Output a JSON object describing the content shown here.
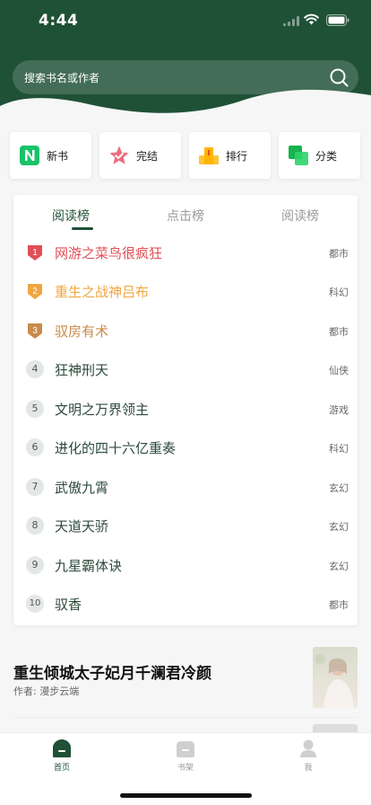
{
  "status_bar": {
    "time": "4:44"
  },
  "search": {
    "placeholder": "搜索书名或作者"
  },
  "quick_links": [
    {
      "label": "新书",
      "icon": "new-badge-icon"
    },
    {
      "label": "完结",
      "icon": "star-icon"
    },
    {
      "label": "排行",
      "icon": "ranking-icon"
    },
    {
      "label": "分类",
      "icon": "category-icon"
    }
  ],
  "rank_tabs": [
    "阅读榜",
    "点击榜",
    "阅读榜"
  ],
  "rank_list": [
    {
      "rank": "1",
      "title": "网游之菜鸟很疯狂",
      "category": "都市"
    },
    {
      "rank": "2",
      "title": "重生之战神吕布",
      "category": "科幻"
    },
    {
      "rank": "3",
      "title": "驭房有术",
      "category": "都市"
    },
    {
      "rank": "4",
      "title": "狂神刑天",
      "category": "仙侠"
    },
    {
      "rank": "5",
      "title": "文明之万界领主",
      "category": "游戏"
    },
    {
      "rank": "6",
      "title": "进化的四十六亿重奏",
      "category": "科幻"
    },
    {
      "rank": "7",
      "title": "武傲九霄",
      "category": "玄幻"
    },
    {
      "rank": "8",
      "title": "天道天骄",
      "category": "玄幻"
    },
    {
      "rank": "9",
      "title": "九星霸体诀",
      "category": "玄幻"
    },
    {
      "rank": "10",
      "title": "驭香",
      "category": "都市"
    }
  ],
  "recommendation": {
    "title": "重生倾城太子妃月千澜君冷颜",
    "author": "作者: 漫步云端"
  },
  "tabbar": [
    {
      "label": "首页",
      "icon": "home-icon",
      "active": true
    },
    {
      "label": "书架",
      "icon": "bookshelf-icon",
      "active": false
    },
    {
      "label": "我",
      "icon": "profile-icon",
      "active": false
    }
  ],
  "colors": {
    "brand": "#1f5136",
    "rank1": "#e04f55",
    "rank2": "#f0a640",
    "rank3": "#c98a4a"
  }
}
